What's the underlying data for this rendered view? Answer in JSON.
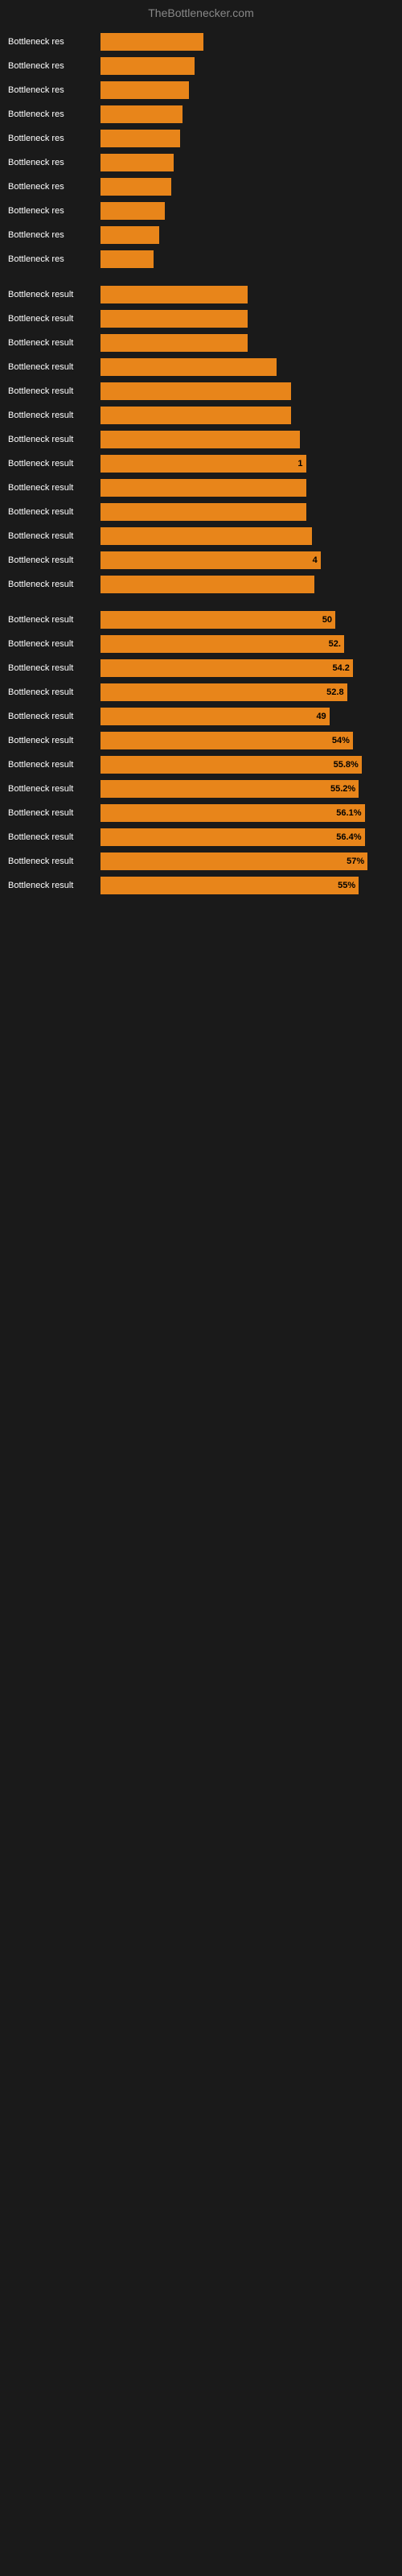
{
  "header": {
    "title": "TheBottlenecker.com"
  },
  "bars": [
    {
      "label": "Bottleneck res",
      "value": "",
      "width": 35
    },
    {
      "label": "Bottleneck res",
      "value": "",
      "width": 32
    },
    {
      "label": "Bottleneck res",
      "value": "",
      "width": 30
    },
    {
      "label": "Bottleneck res",
      "value": "",
      "width": 28
    },
    {
      "label": "Bottleneck res",
      "value": "",
      "width": 27
    },
    {
      "label": "Bottleneck res",
      "value": "",
      "width": 25
    },
    {
      "label": "Bottleneck res",
      "value": "",
      "width": 24
    },
    {
      "label": "Bottleneck res",
      "value": "",
      "width": 22
    },
    {
      "label": "Bottleneck res",
      "value": "",
      "width": 20
    },
    {
      "label": "Bottleneck res",
      "value": "",
      "width": 18
    },
    {
      "label": "Bottleneck result",
      "value": "",
      "width": 50
    },
    {
      "label": "Bottleneck result",
      "value": "",
      "width": 50
    },
    {
      "label": "Bottleneck result",
      "value": "",
      "width": 50
    },
    {
      "label": "Bottleneck result",
      "value": "",
      "width": 60
    },
    {
      "label": "Bottleneck result",
      "value": "",
      "width": 65
    },
    {
      "label": "Bottleneck result",
      "value": "",
      "width": 65
    },
    {
      "label": "Bottleneck result",
      "value": "",
      "width": 68
    },
    {
      "label": "Bottleneck result",
      "value": "1",
      "width": 70
    },
    {
      "label": "Bottleneck result",
      "value": "",
      "width": 70
    },
    {
      "label": "Bottleneck result",
      "value": "",
      "width": 70
    },
    {
      "label": "Bottleneck result",
      "value": "",
      "width": 72
    },
    {
      "label": "Bottleneck result",
      "value": "4",
      "width": 75
    },
    {
      "label": "Bottleneck result",
      "value": "",
      "width": 73
    },
    {
      "label": "Bottleneck result",
      "value": "50",
      "width": 80
    },
    {
      "label": "Bottleneck result",
      "value": "52.",
      "width": 83
    },
    {
      "label": "Bottleneck result",
      "value": "54.2",
      "width": 86
    },
    {
      "label": "Bottleneck result",
      "value": "52.8",
      "width": 84
    },
    {
      "label": "Bottleneck result",
      "value": "49",
      "width": 78
    },
    {
      "label": "Bottleneck result",
      "value": "54%",
      "width": 86
    },
    {
      "label": "Bottleneck result",
      "value": "55.8%",
      "width": 89
    },
    {
      "label": "Bottleneck result",
      "value": "55.2%",
      "width": 88
    },
    {
      "label": "Bottleneck result",
      "value": "56.1%",
      "width": 90
    },
    {
      "label": "Bottleneck result",
      "value": "56.4%",
      "width": 90
    },
    {
      "label": "Bottleneck result",
      "value": "57%",
      "width": 91
    },
    {
      "label": "Bottleneck result",
      "value": "55%",
      "width": 88
    }
  ]
}
